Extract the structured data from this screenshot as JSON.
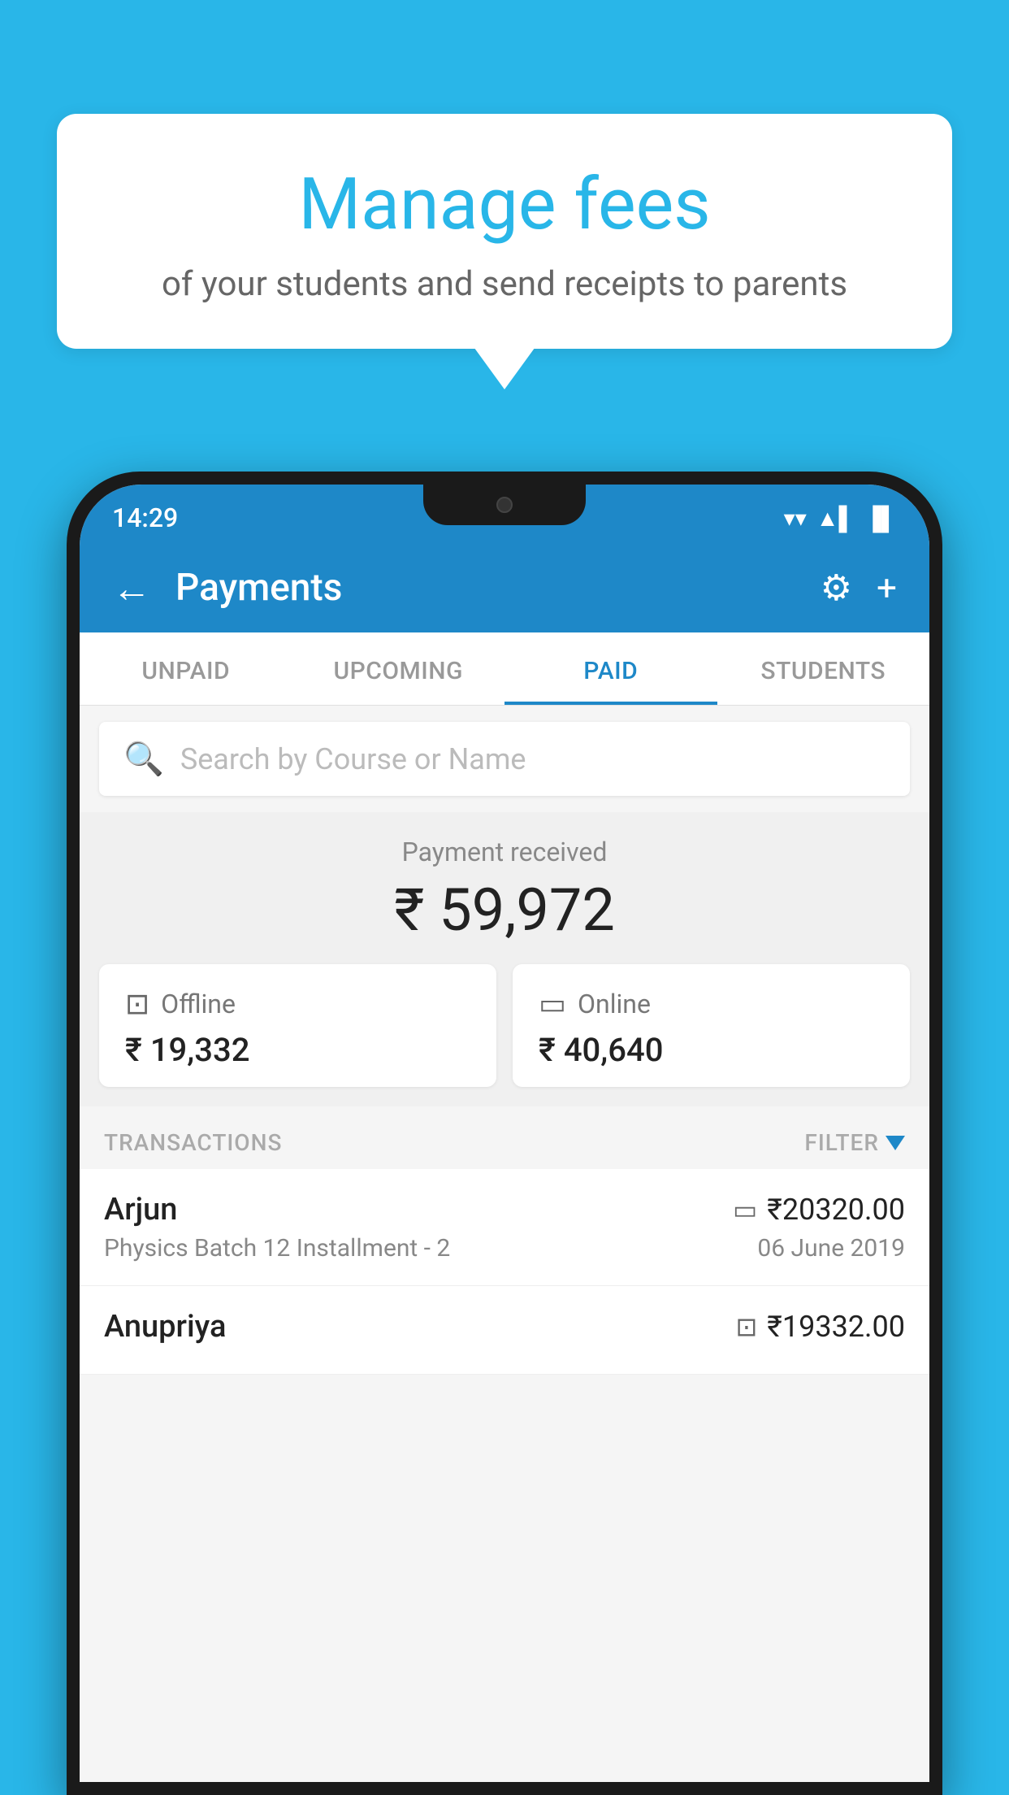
{
  "background_color": "#29b6e8",
  "speech_bubble": {
    "title": "Manage fees",
    "subtitle": "of your students and send receipts to parents"
  },
  "status_bar": {
    "time": "14:29",
    "wifi": "▼",
    "signal": "▲",
    "battery": "■"
  },
  "header": {
    "title": "Payments",
    "back_label": "←",
    "settings_label": "⚙",
    "add_label": "+"
  },
  "tabs": [
    {
      "label": "UNPAID",
      "active": false
    },
    {
      "label": "UPCOMING",
      "active": false
    },
    {
      "label": "PAID",
      "active": true
    },
    {
      "label": "STUDENTS",
      "active": false
    }
  ],
  "search": {
    "placeholder": "Search by Course or Name"
  },
  "payment_summary": {
    "label": "Payment received",
    "total": "₹ 59,972",
    "offline_label": "Offline",
    "offline_amount": "₹ 19,332",
    "online_label": "Online",
    "online_amount": "₹ 40,640"
  },
  "transactions_section": {
    "label": "TRANSACTIONS",
    "filter_label": "FILTER"
  },
  "transactions": [
    {
      "name": "Arjun",
      "course": "Physics Batch 12 Installment - 2",
      "amount": "₹20320.00",
      "date": "06 June 2019",
      "method": "card"
    },
    {
      "name": "Anupriya",
      "course": "",
      "amount": "₹19332.00",
      "date": "",
      "method": "offline"
    }
  ]
}
